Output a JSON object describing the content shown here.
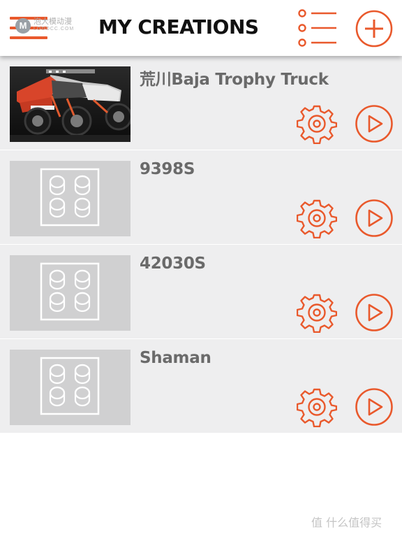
{
  "header": {
    "title": "MY CREATIONS",
    "watermark_badge": "M",
    "watermark_cn": "泡大模动漫",
    "watermark_sub": "LODOCC.COM"
  },
  "creations": [
    {
      "name": "荒川Baja Trophy Truck",
      "thumbnail": "truck-photo"
    },
    {
      "name": "9398S",
      "thumbnail": "brick-placeholder"
    },
    {
      "name": "42030S",
      "thumbnail": "brick-placeholder"
    },
    {
      "name": "Shaman",
      "thumbnail": "brick-placeholder"
    }
  ],
  "footer": {
    "watermark": "值 什么值得买"
  },
  "colors": {
    "accent": "#e9592c",
    "row_bg": "#eeeeef",
    "thumb_bg": "#d0d0d1",
    "title": "#111111",
    "item_text": "#6a6a6a"
  },
  "icons": {
    "menu": "hamburger-icon",
    "list": "list-view-icon",
    "add": "plus-circle-icon",
    "settings": "gear-icon",
    "play": "play-circle-icon"
  }
}
